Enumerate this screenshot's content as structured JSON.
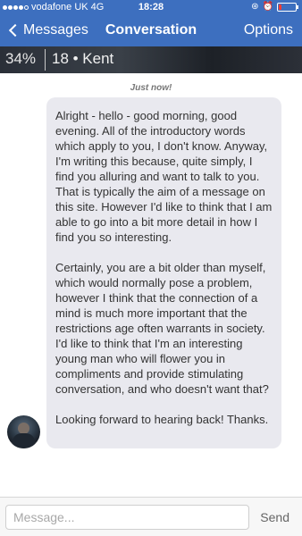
{
  "status_bar": {
    "carrier": "vodafone UK",
    "network": "4G",
    "time": "18:28"
  },
  "nav": {
    "back_label": "Messages",
    "title": "Conversation",
    "options_label": "Options"
  },
  "profile_banner": {
    "percent": "34%",
    "info": "18 • Kent"
  },
  "message": {
    "timestamp": "Just now!",
    "paragraphs": [
      "Alright - hello - good morning, good evening. All of the introductory words which apply to you, I don't know. Anyway, I'm writing this because, quite simply, I find you alluring and want to talk to you. That is typically the aim of a message on this site. However I'd like to think that I am able to go into a bit more detail in how I find you so interesting.",
      "Certainly, you are a bit older than myself, which would normally pose a problem, however I think that the connection of a mind is much more important that the restrictions age often warrants in society. I'd like to think that I'm an interesting young man who will flower you in compliments and provide stimulating conversation, and who doesn't want that?",
      "Looking forward to hearing back! Thanks."
    ]
  },
  "composer": {
    "placeholder": "Message...",
    "send_label": "Send"
  },
  "colors": {
    "nav_background": "#3d6fbf",
    "bubble_background": "#e9e9ef"
  },
  "signal": {
    "bars_filled": 4,
    "bars_total": 5
  },
  "battery": {
    "level_percent": 15
  }
}
